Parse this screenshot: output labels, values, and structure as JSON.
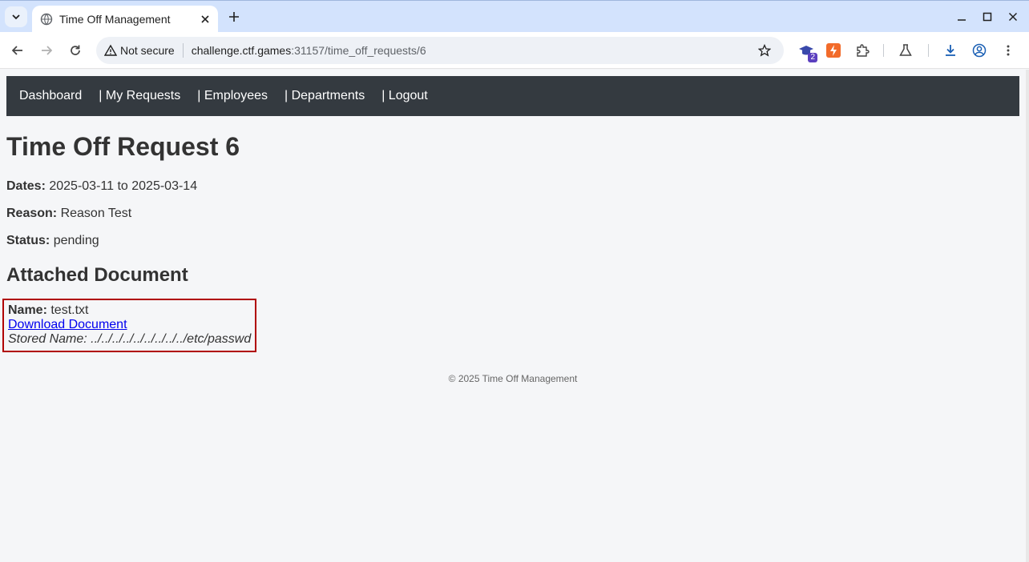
{
  "browser": {
    "tab_title": "Time Off Management",
    "address": {
      "security_label": "Not secure",
      "host": "challenge.ctf.games",
      "path": ":31157/time_off_requests/6"
    },
    "extensions_badge": "2"
  },
  "navbar": {
    "items": [
      {
        "label": "Dashboard"
      },
      {
        "label": "| My Requests"
      },
      {
        "label": "| Employees"
      },
      {
        "label": "| Departments"
      },
      {
        "label": "| Logout"
      }
    ]
  },
  "request": {
    "title": "Time Off Request 6",
    "dates_label": "Dates:",
    "dates_value": "2025-03-11 to 2025-03-14",
    "reason_label": "Reason:",
    "reason_value": "Reason Test",
    "status_label": "Status:",
    "status_value": "pending"
  },
  "document": {
    "section_title": "Attached Document",
    "name_label": "Name:",
    "name_value": "test.txt",
    "download_label": "Download Document",
    "stored_name": "Stored Name: ../../../../../../../../../etc/passwd"
  },
  "footer": {
    "text": "© 2025 Time Off Management"
  },
  "colors": {
    "navbar_bg": "#343a40",
    "highlight_border": "#b00000",
    "link": "#0000ee"
  }
}
